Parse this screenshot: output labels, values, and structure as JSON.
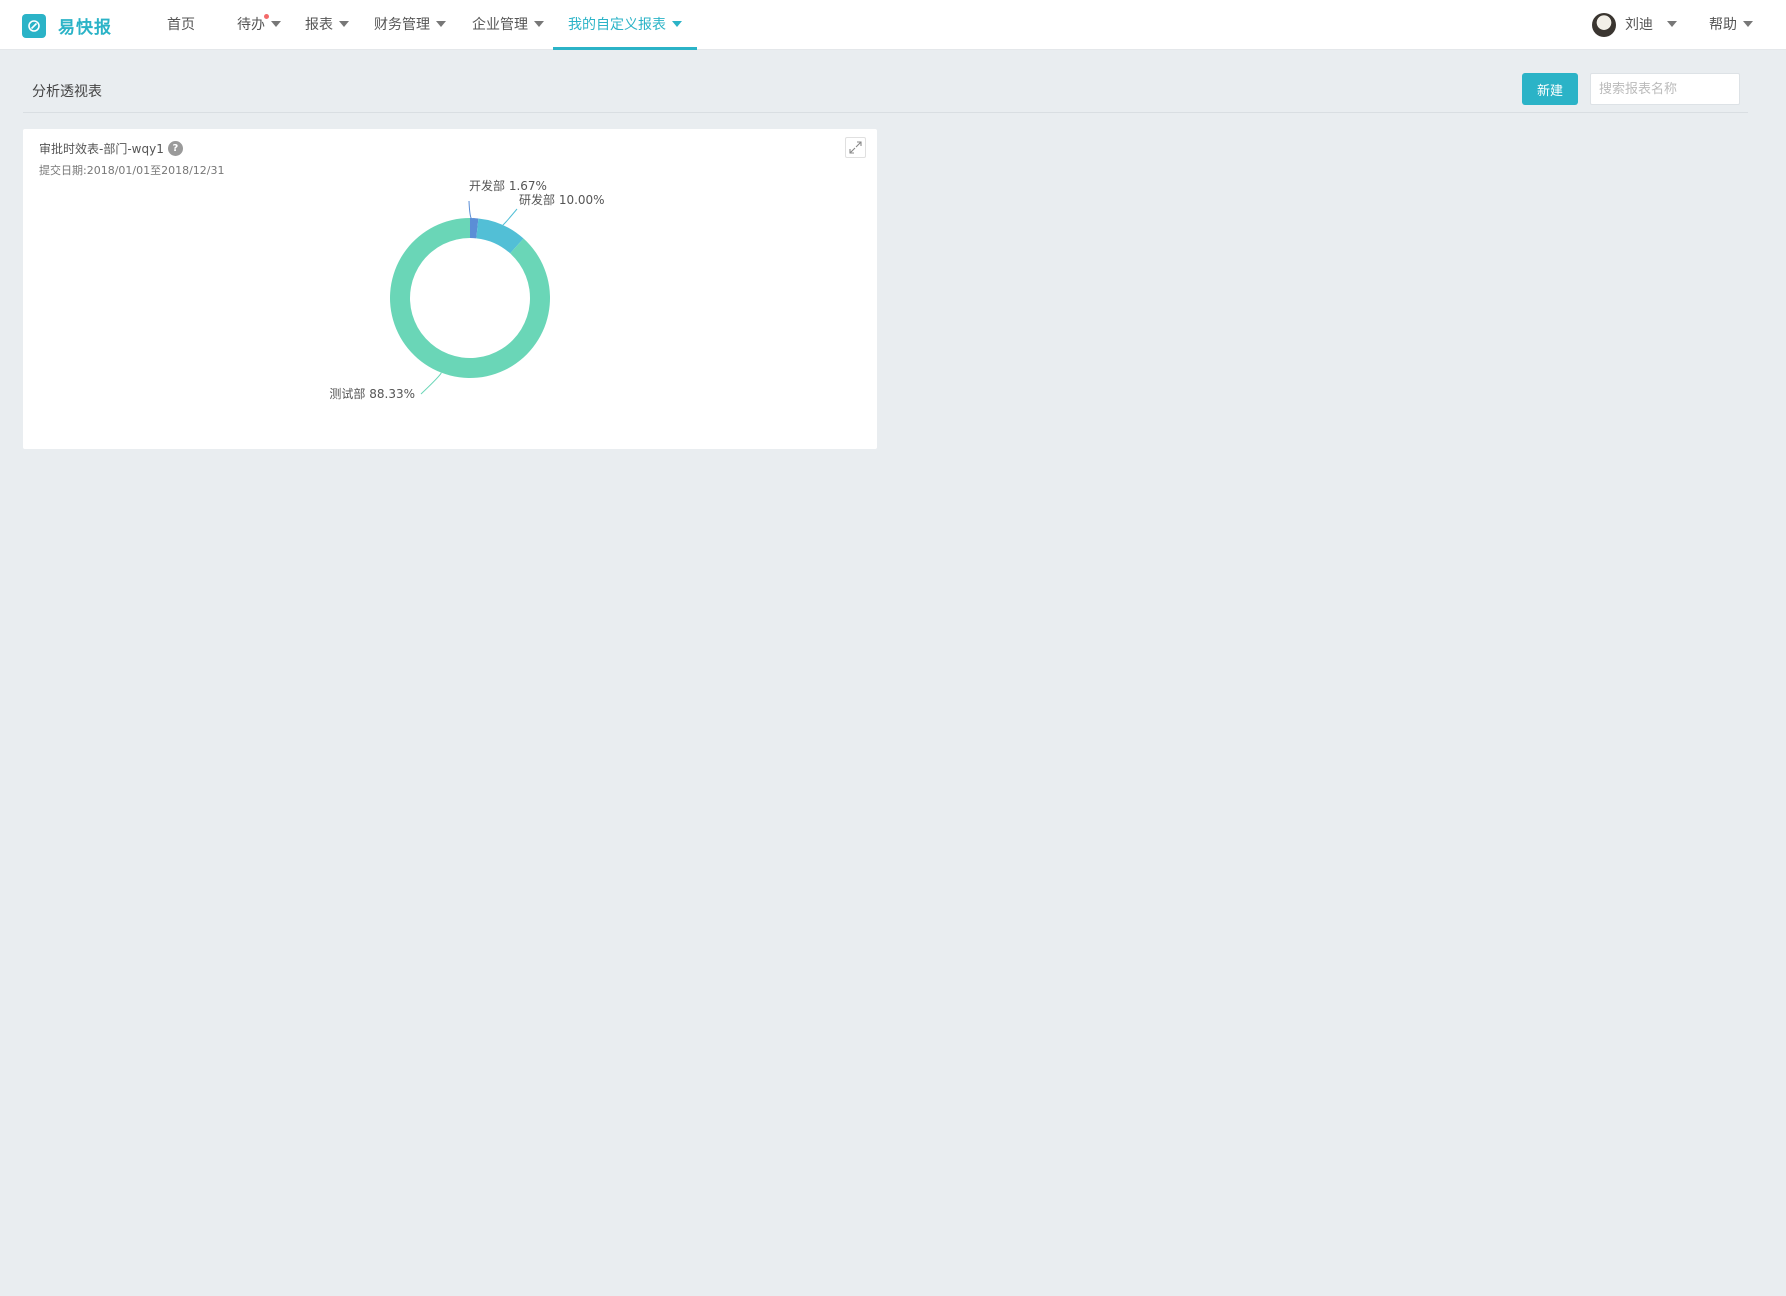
{
  "brand": {
    "name": "易快报"
  },
  "nav": {
    "home": "首页",
    "todo": "待办",
    "reports": "报表",
    "finance": "财务管理",
    "enterprise": "企业管理",
    "custom_reports": "我的自定义报表"
  },
  "user": {
    "name": "刘迪",
    "help": "帮助"
  },
  "page": {
    "title": "分析透视表",
    "new_button": "新建",
    "search_placeholder": "搜索报表名称"
  },
  "card": {
    "title": "审批时效表-部门-wqy1",
    "subtitle": "提交日期:2018/01/01至2018/12/31"
  },
  "colors": {
    "accent": "#2bb3c7",
    "notify_dot": "#f36a6a"
  },
  "chart_data": {
    "type": "pie",
    "donut": true,
    "slices": [
      {
        "name": "开发部",
        "value": 1.67,
        "label": "开发部 1.67%",
        "color": "#5b8ed6"
      },
      {
        "name": "研发部",
        "value": 10.0,
        "label": "研发部 10.00%",
        "color": "#52bfd6"
      },
      {
        "name": "测试部",
        "value": 88.33,
        "label": "测试部 88.33%",
        "color": "#6ad6b7"
      }
    ]
  }
}
